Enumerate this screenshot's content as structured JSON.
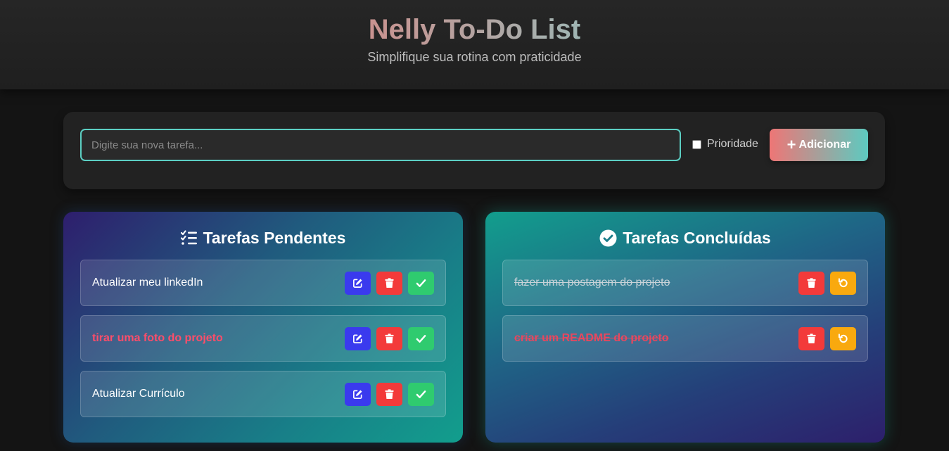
{
  "header": {
    "title": "Nelly To-Do List",
    "subtitle": "Simplifique sua rotina com praticidade"
  },
  "form": {
    "input_placeholder": "Digite sua nova tarefa...",
    "input_value": "",
    "priority_label": "Prioridade",
    "priority_checked": false,
    "add_label": "Adicionar"
  },
  "pending": {
    "title": "Tarefas Pendentes",
    "icon": "list-check-icon",
    "tasks": [
      {
        "text": "Atualizar meu linkedIn",
        "priority": false
      },
      {
        "text": "tirar uma foto do projeto",
        "priority": true
      },
      {
        "text": "Atualizar Currículo",
        "priority": false
      }
    ]
  },
  "done": {
    "title": "Tarefas Concluídas",
    "icon": "check-circle-icon",
    "tasks": [
      {
        "text": "fazer uma postagem do projeto",
        "priority": false
      },
      {
        "text": "criar um README do projeto",
        "priority": true
      }
    ]
  },
  "colors": {
    "accent": "#5ccfc3",
    "edit": "#3a3aee",
    "delete": "#f33a3a",
    "complete": "#2fcb6f",
    "undo": "#f9a90e",
    "priority_text": "#ff4d6a"
  }
}
